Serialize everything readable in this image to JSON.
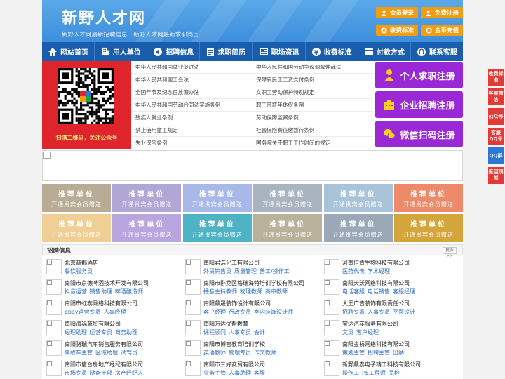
{
  "header": {
    "logo": "新野人才网",
    "slogans": [
      "新野人才网最新招聘信息",
      "新野人才网最新求职简历"
    ],
    "buttons": [
      {
        "label": "会员登录",
        "icon": "user-icon"
      },
      {
        "label": "免费注册",
        "icon": "person-add-icon"
      },
      {
        "label": "收费标准",
        "icon": "yen-icon"
      },
      {
        "label": "金币充值",
        "icon": "coin-icon"
      }
    ],
    "button_color": "#f39c12",
    "bg_color": "#4a9be2"
  },
  "nav": {
    "items": [
      {
        "label": "网站首页",
        "icon": "home-icon"
      },
      {
        "label": "用人单位",
        "icon": "building-icon"
      },
      {
        "label": "招聘信息",
        "icon": "megaphone-icon"
      },
      {
        "label": "求职简历",
        "icon": "resume-icon"
      },
      {
        "label": "职场资讯",
        "icon": "news-icon"
      },
      {
        "label": "收费标准",
        "icon": "yen-icon"
      },
      {
        "label": "付款方式",
        "icon": "payment-icon"
      },
      {
        "label": "联系客服",
        "icon": "headset-icon"
      }
    ],
    "bg_color": "#1a5dad"
  },
  "qr": {
    "caption": "扫描二维码，关注公众号"
  },
  "laws": {
    "left": [
      "中华人民共和国就业促进法",
      "中华人民共和国工会法",
      "全国年节及纪念日放假办法",
      "中华人民共和国劳动合同法实施条例",
      "残疾人就业条例",
      "禁止使用童工规定",
      "失业保险条例"
    ],
    "right": [
      "中华人民共和国劳动争议调解仲裁法",
      "保障农民工工资支付条例",
      "女职工劳动保护特别规定",
      "职工带薪年休假条例",
      "劳动保障监察条例",
      "社会保险费征缴暂行条例",
      "国务院关于职工工作时间的规定"
    ]
  },
  "register": [
    {
      "label": "个人求职注册",
      "icon": "person-icon"
    },
    {
      "label": "企业招聘注册",
      "icon": "company-icon"
    },
    {
      "label": "微信扫码注册",
      "icon": "wechat-icon"
    }
  ],
  "recommend": {
    "title": "推荐单位",
    "subtitle": "开通贵宾会员赠送",
    "row1_colors": [
      "#b8ac96",
      "#b1a7d6",
      "#a8b8e8",
      "#a8b4c0",
      "#a9c4d8",
      "#ec8a6a"
    ],
    "row2_colors": [
      "#f0cf95",
      "#b9a6df",
      "#4fb3c6",
      "#b9b19a",
      "#9aa8b8",
      "#d4a53a"
    ]
  },
  "jobs": {
    "title": "招聘信息",
    "more": "更多>>",
    "companies": [
      {
        "name": "北京商都酒店",
        "jobs": [
          "餐饮服务员"
        ]
      },
      {
        "name": "南阳君浩化工有限公司",
        "jobs": [
          "外贸销售员",
          "质量管理",
          "普工/操作工"
        ]
      },
      {
        "name": "河南倍肯生物科技有限公司",
        "jobs": [
          "医药代表",
          "学术经理"
        ]
      },
      {
        "name": "南阳市京德啤酒技术开发有限公司",
        "jobs": [
          "抖音运营",
          "销售助理",
          "啤酒酿造师"
        ]
      },
      {
        "name": "南阳市卧龙区格瑞海特培训学校有限公司",
        "jobs": [
          "播音主持教师",
          "物理教师",
          "高中教师"
        ]
      },
      {
        "name": "南阳天沃网络科技有限公司",
        "jobs": [
          "电话客服",
          "电话销售",
          "客服经理"
        ]
      },
      {
        "name": "南阳市虹泰网络科技有限公司",
        "jobs": [
          "ebay运营专员",
          "人事经理"
        ]
      },
      {
        "name": "南阳鼎晟装饰设计有限公司",
        "jobs": [
          "客户经理",
          "行政专员",
          "室内装饰设计师"
        ]
      },
      {
        "name": "大王广告装饰有限责任公司",
        "jobs": [
          "招聘专员",
          "人事专员",
          "平面设计"
        ]
      },
      {
        "name": "南阳海福商贸有限公司",
        "jobs": [
          "经理助理",
          "运营专员",
          "商务助理"
        ]
      },
      {
        "name": "南阳万达优帮教育",
        "jobs": [
          "课程顾问",
          "人事专员",
          "会计"
        ]
      },
      {
        "name": "宝达汽车服务有限公司",
        "jobs": [
          "文员",
          "客户经理"
        ]
      },
      {
        "name": "南阳骆瑞汽车销售服务有限公司",
        "jobs": [
          "事故车主管",
          "区域助理",
          "试驾员"
        ]
      },
      {
        "name": "南阳市博智教育培训学校",
        "jobs": [
          "英语教师",
          "物理专员",
          "作文教师"
        ]
      },
      {
        "name": "南阳金桥网络科技有限公司",
        "jobs": [
          "策划主管",
          "招聘主管",
          "出纳"
        ]
      },
      {
        "name": "南阳市信合房地产经纪有限公司",
        "jobs": [
          "市场专员",
          "储备干部",
          "房产经纪人"
        ]
      },
      {
        "name": "南阳市三好商贸有限公司",
        "jobs": [
          "业务主管",
          "人事助理",
          "客服"
        ]
      },
      {
        "name": "新野鼎泰电子精工科技有限公司",
        "jobs": [
          "操作工",
          "PE工程师",
          "品检"
        ]
      }
    ]
  },
  "float_bar": [
    "收费标准",
    "客服微信",
    "公众号",
    "客服QQ号",
    "QQ群",
    "返回顶部"
  ]
}
